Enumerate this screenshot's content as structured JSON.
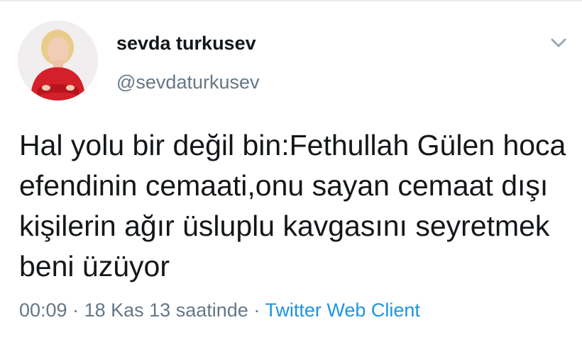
{
  "tweet": {
    "author": {
      "display_name": "sevda turkusev",
      "handle": "@sevdaturkusev"
    },
    "text": "Hal yolu bir değil bin:Fethullah Gülen hoca efendinin cemaati,onu sayan cemaat dışı kişilerin ağır üsluplu kavgasını seyretmek beni üzüyor",
    "time": "00:09",
    "separator": "·",
    "date": "18 Kas 13 saatinde",
    "source": "Twitter Web Client"
  },
  "icons": {
    "menu": "chevron-down-icon"
  },
  "colors": {
    "text_primary": "#14171a",
    "text_secondary": "#657786",
    "link": "#1b95e0"
  }
}
